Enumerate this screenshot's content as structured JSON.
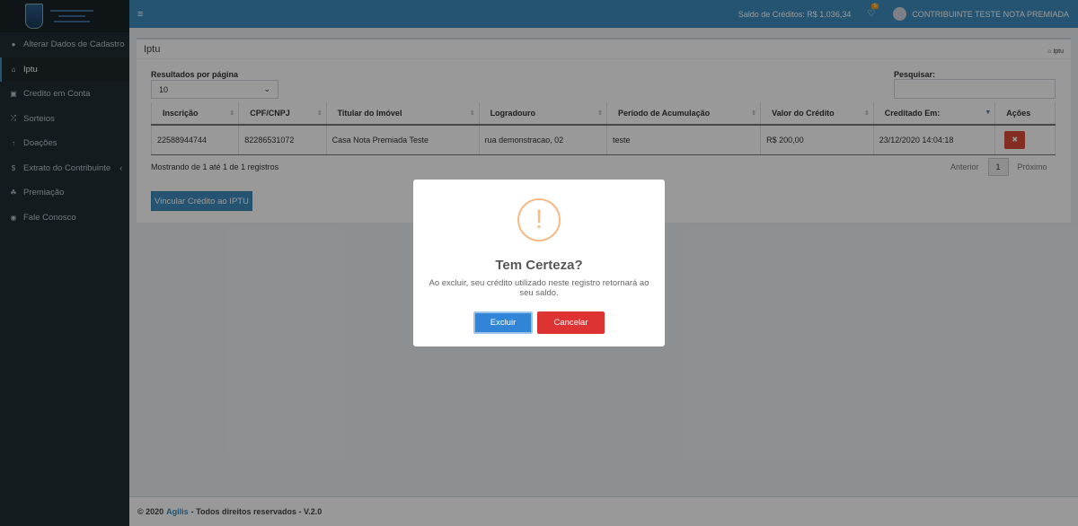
{
  "header": {
    "credits_label": "Saldo de Créditos: R$ 1.036,34",
    "notification_count": "5",
    "user_name": "CONTRIBUINTE TESTE NOTA PREMIADA"
  },
  "sidebar": {
    "items": [
      {
        "label": "Alterar Dados de Cadastro",
        "icon": "user-icon"
      },
      {
        "label": "Iptu",
        "icon": "home-icon"
      },
      {
        "label": "Credito em Conta",
        "icon": "money-icon"
      },
      {
        "label": "Sorteios",
        "icon": "random-icon"
      },
      {
        "label": "Doações",
        "icon": "arrow-up-icon"
      },
      {
        "label": "Extrato do Contribuinte",
        "icon": "dollar-icon"
      },
      {
        "label": "Premiação",
        "icon": "trophy-icon"
      },
      {
        "label": "Fale Conosco",
        "icon": "comments-icon"
      }
    ]
  },
  "box": {
    "title": "Iptu",
    "breadcrumb": "Iptu",
    "length_label": "Resultados por página",
    "length_value": "10",
    "search_label": "Pesquisar:"
  },
  "table": {
    "headers": [
      "Inscrição",
      "CPF/CNPJ",
      "Titular do Imóvel",
      "Logradouro",
      "Período de Acumulação",
      "Valor do Crédito",
      "Creditado Em:",
      "Ações"
    ],
    "rows": [
      [
        "22588944744",
        "82286531072",
        "Casa Nota Premiada Teste",
        "rua demonstracao, 02",
        "teste",
        "R$ 200,00",
        "23/12/2020 14:04:18"
      ]
    ]
  },
  "pagination": {
    "info": "Mostrando de 1 até 1 de 1 registros",
    "previous": "Anterior",
    "page": "1",
    "next": "Próximo"
  },
  "vincular_label": "Vincular Crédito ao IPTU",
  "footer": {
    "prefix": "© 2020",
    "brand": "Agilis",
    "suffix": "- Todos direitos reservados - V.2.0"
  },
  "modal": {
    "icon": "!",
    "title": "Tem Certeza?",
    "text": "Ao excluir, seu crédito utilizado neste registro retornará ao seu saldo.",
    "confirm": "Excluir",
    "cancel": "Cancelar"
  }
}
